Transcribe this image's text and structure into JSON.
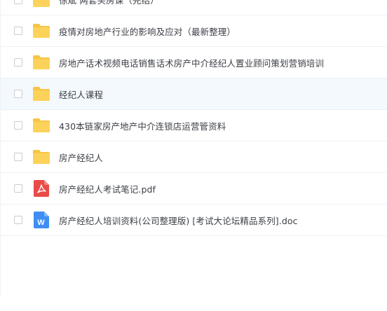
{
  "files": [
    {
      "name": "徐斌 两套买房课（完结）",
      "icon": "folder-icon",
      "type": "folder"
    },
    {
      "name": "疫情对房地产行业的影响及应对（最新整理）",
      "icon": "folder-icon",
      "type": "folder"
    },
    {
      "name": "房地产话术视频电话销售话术房产中介经纪人置业顾问策划营销培训",
      "icon": "folder-icon",
      "type": "folder"
    },
    {
      "name": "经纪人课程",
      "icon": "folder-icon",
      "type": "folder"
    },
    {
      "name": "430本链家房产地产中介连锁店运营管资料",
      "icon": "folder-icon",
      "type": "folder"
    },
    {
      "name": "房产经纪人",
      "icon": "folder-icon",
      "type": "folder"
    },
    {
      "name": "房产经纪人考试笔记.pdf",
      "icon": "pdf-icon",
      "type": "pdf"
    },
    {
      "name": "房产经纪人培训资料(公司整理版) [考试大论坛精品系列].doc",
      "icon": "word-doc-icon",
      "type": "doc"
    }
  ],
  "colors": {
    "folder": "#fcd25a",
    "folder_tab": "#f7c545",
    "pdf": "#e94b47",
    "doc": "#3f8ef4",
    "selected_row": "#f4f9fe"
  }
}
